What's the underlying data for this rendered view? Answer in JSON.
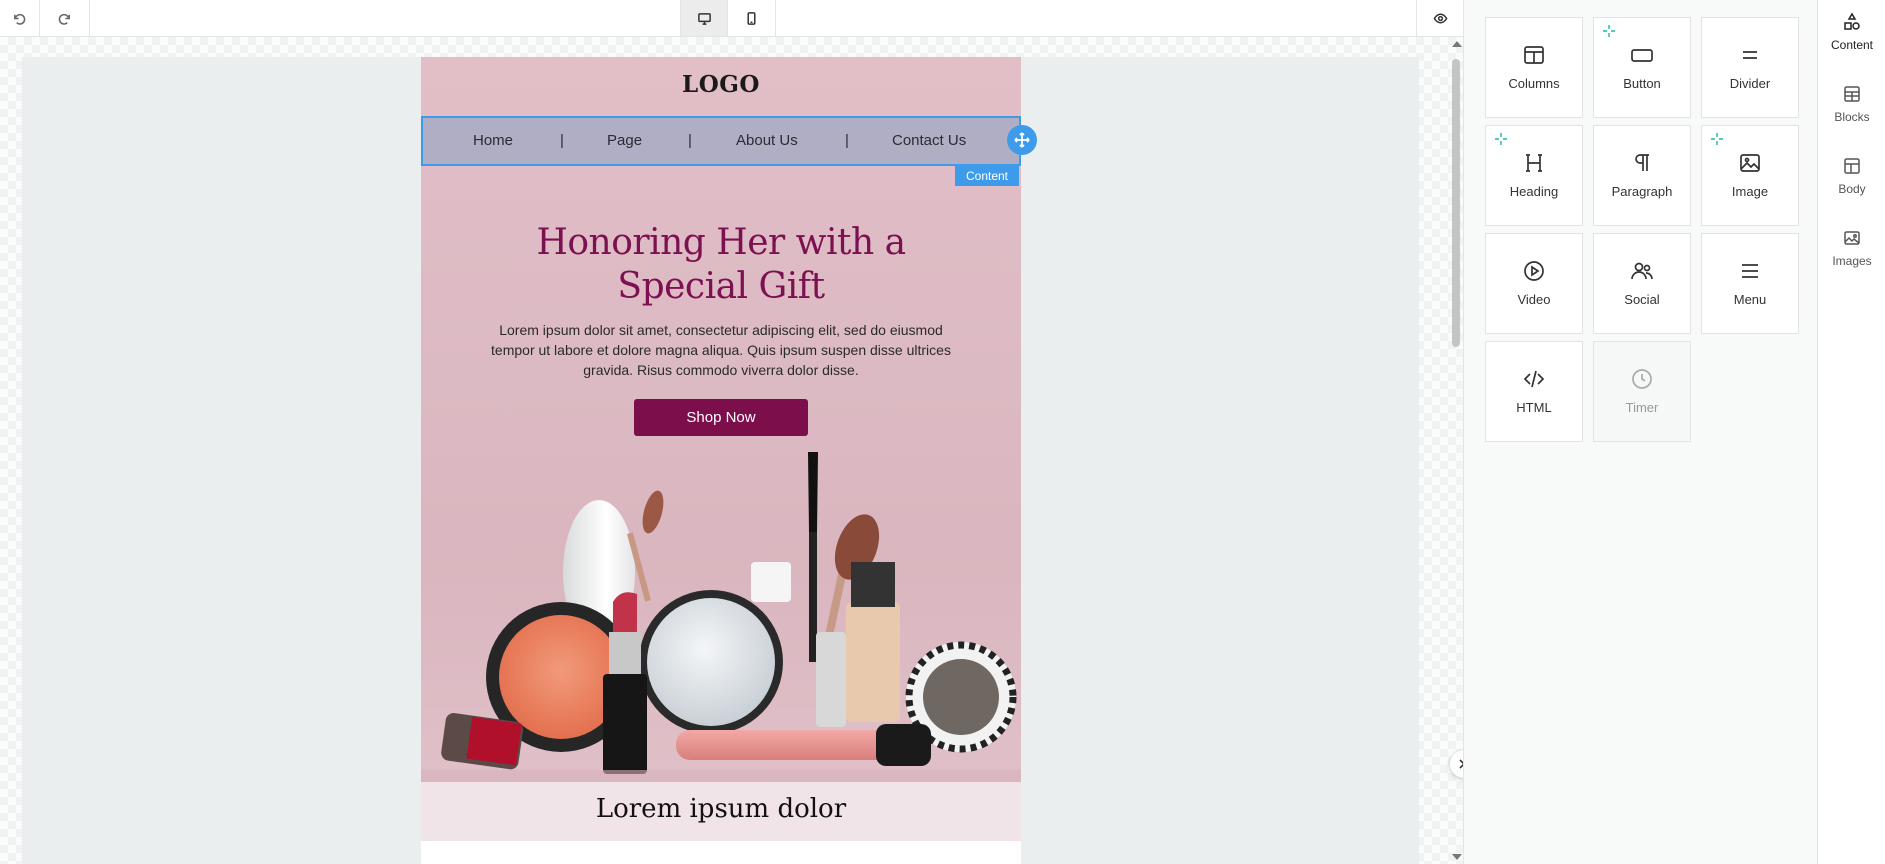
{
  "email": {
    "logo": "LOGO",
    "nav": [
      "Home",
      "Page",
      "About Us",
      "Contact Us"
    ],
    "nav_separator": "|",
    "content_tag": "Content",
    "headline_line1": "Honoring Her with a",
    "headline_line2": "Special Gift",
    "body": "Lorem ipsum dolor sit amet, consectetur adipiscing elit, sed do eiusmod tempor ut labore et dolore magna aliqua. Quis ipsum suspen disse ultrices gravida. Risus commodo viverra dolor disse.",
    "button": "Shop Now",
    "subheading": "Lorem ipsum dolor",
    "colors": {
      "headline": "#7c1050",
      "button_bg": "#7c0e4c",
      "selection": "#3d9be9",
      "hero_bg": "#dcbac3"
    }
  },
  "tools": [
    {
      "label": "Columns",
      "icon": "columns-icon",
      "sparkle": false,
      "disabled": false
    },
    {
      "label": "Button",
      "icon": "button-icon",
      "sparkle": true,
      "disabled": false
    },
    {
      "label": "Divider",
      "icon": "divider-icon",
      "sparkle": false,
      "disabled": false
    },
    {
      "label": "Heading",
      "icon": "heading-icon",
      "sparkle": true,
      "disabled": false
    },
    {
      "label": "Paragraph",
      "icon": "paragraph-icon",
      "sparkle": false,
      "disabled": false
    },
    {
      "label": "Image",
      "icon": "image-icon",
      "sparkle": true,
      "disabled": false
    },
    {
      "label": "Video",
      "icon": "video-icon",
      "sparkle": false,
      "disabled": false
    },
    {
      "label": "Social",
      "icon": "social-icon",
      "sparkle": false,
      "disabled": false
    },
    {
      "label": "Menu",
      "icon": "menu-icon",
      "sparkle": false,
      "disabled": false
    },
    {
      "label": "HTML",
      "icon": "html-icon",
      "sparkle": false,
      "disabled": false
    },
    {
      "label": "Timer",
      "icon": "timer-icon",
      "sparkle": false,
      "disabled": true
    }
  ],
  "tabs": [
    {
      "label": "Content",
      "icon": "shapes-icon",
      "active": true
    },
    {
      "label": "Blocks",
      "icon": "blocks-icon",
      "active": false
    },
    {
      "label": "Body",
      "icon": "body-icon",
      "active": false
    },
    {
      "label": "Images",
      "icon": "images-icon",
      "active": false
    }
  ],
  "toolbar": {
    "undo_icon": "undo-icon",
    "redo_icon": "redo-icon",
    "desktop_icon": "desktop-icon",
    "mobile_icon": "mobile-icon",
    "preview_icon": "eye-icon"
  }
}
